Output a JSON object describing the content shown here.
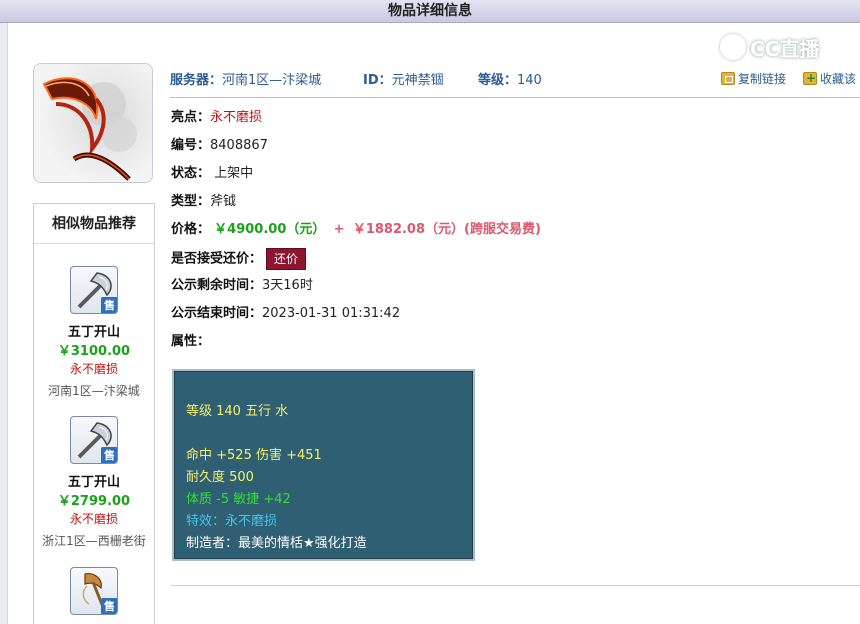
{
  "page": {
    "title": "物品详细信息"
  },
  "watermark": {
    "text": "CC直播"
  },
  "header": {
    "server_label": "服务器：",
    "server_value": "河南1区—汴梁城",
    "id_label": "ID：",
    "id_value": "元神禁锢",
    "level_label": "等级：",
    "level_value": "140",
    "copy_link": "复制链接",
    "favorite": "收藏该"
  },
  "details": {
    "highlight_label": "亮点：",
    "highlight_value": "永不磨损",
    "number_label": "编号：",
    "number_value": "8408867",
    "status_label": "状态：",
    "status_value": "上架中",
    "type_label": "类型：",
    "type_value": "斧钺",
    "price_label": "价格：",
    "price_main": "￥4900.00（元）",
    "price_plus": "+",
    "price_fee": "￥1882.08（元）(跨服交易费)",
    "counter_label": "是否接受还价：",
    "counter_button": "还价",
    "remaining_label": "公示剩余时间：",
    "remaining_value": "3天16时",
    "end_label": "公示结束时间：",
    "end_value": "2023-01-31 01:31:42",
    "attr_label": "属性："
  },
  "attributes": {
    "line1": "等级 140 五行 水",
    "line2": "命中 +525 伤害 +451",
    "line3": "耐久度 500",
    "line4": "体质 -5 敏捷 +42",
    "line5": "特效：永不磨损",
    "line6": "制造者：最美的情栝★强化打造"
  },
  "similar": {
    "title": "相似物品推荐",
    "sell_badge": "售",
    "items": [
      {
        "name": "五丁开山",
        "price": "￥3100.00",
        "tag": "永不磨损",
        "server": "河南1区—汴梁城"
      },
      {
        "name": "五丁开山",
        "price": "￥2799.00",
        "tag": "永不磨损",
        "server": "浙江1区—西栅老街"
      },
      {
        "name": "",
        "price": "",
        "tag": "",
        "server": ""
      }
    ]
  },
  "colors": {
    "price_green": "#19a319",
    "price_red": "#e0566d",
    "tag_red": "#c51010",
    "link_blue": "#2b5c92",
    "panel_bg": "#2f5f73",
    "button_bg": "#8e1530"
  },
  "icons": [
    "axe-weapon-icon",
    "sell-badge-icon",
    "copy-link-icon",
    "favorite-add-icon",
    "cc-logo-icon"
  ]
}
